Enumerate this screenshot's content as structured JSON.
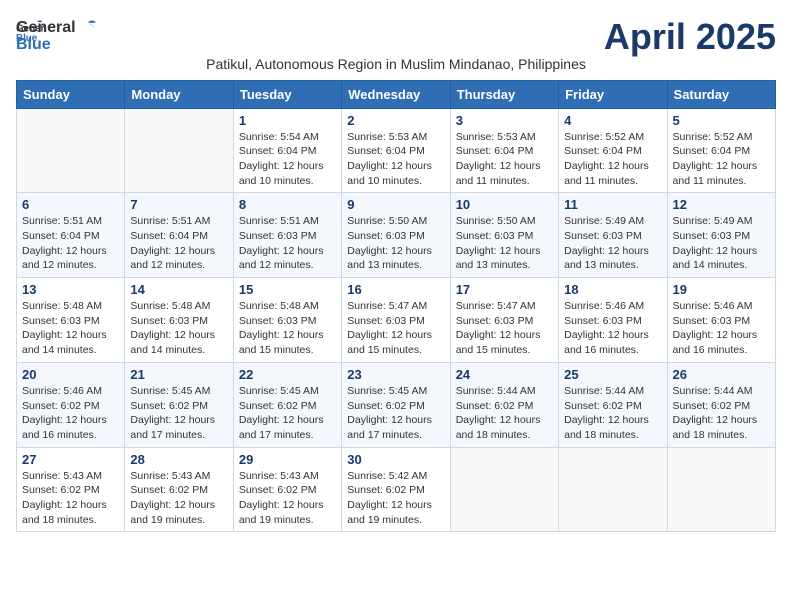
{
  "header": {
    "logo_general": "General",
    "logo_blue": "Blue",
    "month_title": "April 2025",
    "subtitle": "Patikul, Autonomous Region in Muslim Mindanao, Philippines"
  },
  "days_of_week": [
    "Sunday",
    "Monday",
    "Tuesday",
    "Wednesday",
    "Thursday",
    "Friday",
    "Saturday"
  ],
  "weeks": [
    [
      {
        "day": "",
        "info": ""
      },
      {
        "day": "",
        "info": ""
      },
      {
        "day": "1",
        "info": "Sunrise: 5:54 AM\nSunset: 6:04 PM\nDaylight: 12 hours\nand 10 minutes."
      },
      {
        "day": "2",
        "info": "Sunrise: 5:53 AM\nSunset: 6:04 PM\nDaylight: 12 hours\nand 10 minutes."
      },
      {
        "day": "3",
        "info": "Sunrise: 5:53 AM\nSunset: 6:04 PM\nDaylight: 12 hours\nand 11 minutes."
      },
      {
        "day": "4",
        "info": "Sunrise: 5:52 AM\nSunset: 6:04 PM\nDaylight: 12 hours\nand 11 minutes."
      },
      {
        "day": "5",
        "info": "Sunrise: 5:52 AM\nSunset: 6:04 PM\nDaylight: 12 hours\nand 11 minutes."
      }
    ],
    [
      {
        "day": "6",
        "info": "Sunrise: 5:51 AM\nSunset: 6:04 PM\nDaylight: 12 hours\nand 12 minutes."
      },
      {
        "day": "7",
        "info": "Sunrise: 5:51 AM\nSunset: 6:04 PM\nDaylight: 12 hours\nand 12 minutes."
      },
      {
        "day": "8",
        "info": "Sunrise: 5:51 AM\nSunset: 6:03 PM\nDaylight: 12 hours\nand 12 minutes."
      },
      {
        "day": "9",
        "info": "Sunrise: 5:50 AM\nSunset: 6:03 PM\nDaylight: 12 hours\nand 13 minutes."
      },
      {
        "day": "10",
        "info": "Sunrise: 5:50 AM\nSunset: 6:03 PM\nDaylight: 12 hours\nand 13 minutes."
      },
      {
        "day": "11",
        "info": "Sunrise: 5:49 AM\nSunset: 6:03 PM\nDaylight: 12 hours\nand 13 minutes."
      },
      {
        "day": "12",
        "info": "Sunrise: 5:49 AM\nSunset: 6:03 PM\nDaylight: 12 hours\nand 14 minutes."
      }
    ],
    [
      {
        "day": "13",
        "info": "Sunrise: 5:48 AM\nSunset: 6:03 PM\nDaylight: 12 hours\nand 14 minutes."
      },
      {
        "day": "14",
        "info": "Sunrise: 5:48 AM\nSunset: 6:03 PM\nDaylight: 12 hours\nand 14 minutes."
      },
      {
        "day": "15",
        "info": "Sunrise: 5:48 AM\nSunset: 6:03 PM\nDaylight: 12 hours\nand 15 minutes."
      },
      {
        "day": "16",
        "info": "Sunrise: 5:47 AM\nSunset: 6:03 PM\nDaylight: 12 hours\nand 15 minutes."
      },
      {
        "day": "17",
        "info": "Sunrise: 5:47 AM\nSunset: 6:03 PM\nDaylight: 12 hours\nand 15 minutes."
      },
      {
        "day": "18",
        "info": "Sunrise: 5:46 AM\nSunset: 6:03 PM\nDaylight: 12 hours\nand 16 minutes."
      },
      {
        "day": "19",
        "info": "Sunrise: 5:46 AM\nSunset: 6:03 PM\nDaylight: 12 hours\nand 16 minutes."
      }
    ],
    [
      {
        "day": "20",
        "info": "Sunrise: 5:46 AM\nSunset: 6:02 PM\nDaylight: 12 hours\nand 16 minutes."
      },
      {
        "day": "21",
        "info": "Sunrise: 5:45 AM\nSunset: 6:02 PM\nDaylight: 12 hours\nand 17 minutes."
      },
      {
        "day": "22",
        "info": "Sunrise: 5:45 AM\nSunset: 6:02 PM\nDaylight: 12 hours\nand 17 minutes."
      },
      {
        "day": "23",
        "info": "Sunrise: 5:45 AM\nSunset: 6:02 PM\nDaylight: 12 hours\nand 17 minutes."
      },
      {
        "day": "24",
        "info": "Sunrise: 5:44 AM\nSunset: 6:02 PM\nDaylight: 12 hours\nand 18 minutes."
      },
      {
        "day": "25",
        "info": "Sunrise: 5:44 AM\nSunset: 6:02 PM\nDaylight: 12 hours\nand 18 minutes."
      },
      {
        "day": "26",
        "info": "Sunrise: 5:44 AM\nSunset: 6:02 PM\nDaylight: 12 hours\nand 18 minutes."
      }
    ],
    [
      {
        "day": "27",
        "info": "Sunrise: 5:43 AM\nSunset: 6:02 PM\nDaylight: 12 hours\nand 18 minutes."
      },
      {
        "day": "28",
        "info": "Sunrise: 5:43 AM\nSunset: 6:02 PM\nDaylight: 12 hours\nand 19 minutes."
      },
      {
        "day": "29",
        "info": "Sunrise: 5:43 AM\nSunset: 6:02 PM\nDaylight: 12 hours\nand 19 minutes."
      },
      {
        "day": "30",
        "info": "Sunrise: 5:42 AM\nSunset: 6:02 PM\nDaylight: 12 hours\nand 19 minutes."
      },
      {
        "day": "",
        "info": ""
      },
      {
        "day": "",
        "info": ""
      },
      {
        "day": "",
        "info": ""
      }
    ]
  ]
}
